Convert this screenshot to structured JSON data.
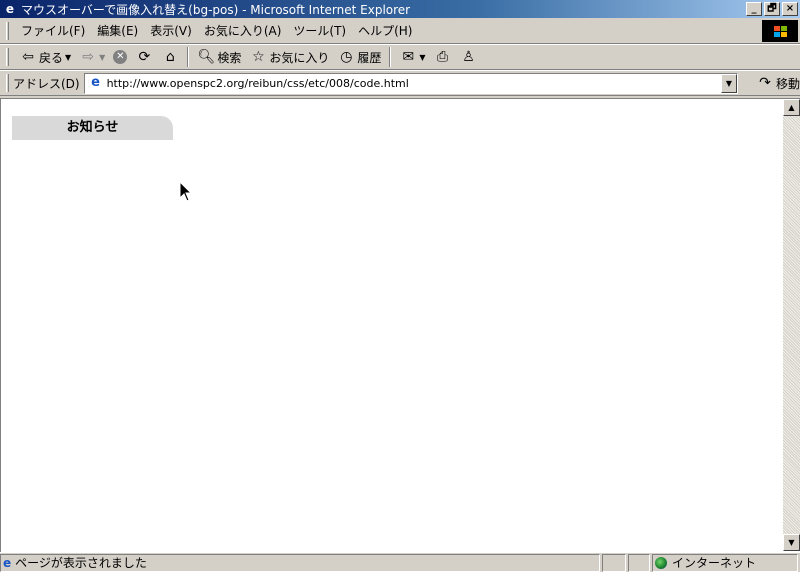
{
  "window": {
    "title": "マウスオーバーで画像入れ替え(bg-pos) - Microsoft Internet Explorer",
    "minimize": "_",
    "restore": "🗗",
    "close": "×"
  },
  "menu": {
    "items": [
      "ファイル(F)",
      "編集(E)",
      "表示(V)",
      "お気に入り(A)",
      "ツール(T)",
      "ヘルプ(H)"
    ]
  },
  "toolbar": {
    "back": "戻る",
    "search": "検索",
    "favorites": "お気に入り",
    "history": "履歴"
  },
  "address": {
    "label": "アドレス(D)",
    "url": "http://www.openspc2.org/reibun/css/etc/008/code.html",
    "go": "移動"
  },
  "page": {
    "notice_title": "お知らせ"
  },
  "status": {
    "message": "ページが表示されました",
    "zone": "インターネット"
  },
  "colors": {
    "titlebar_start": "#0a246a",
    "chrome": "#d4d0c8",
    "notice_bg": "#d9d9d9"
  }
}
